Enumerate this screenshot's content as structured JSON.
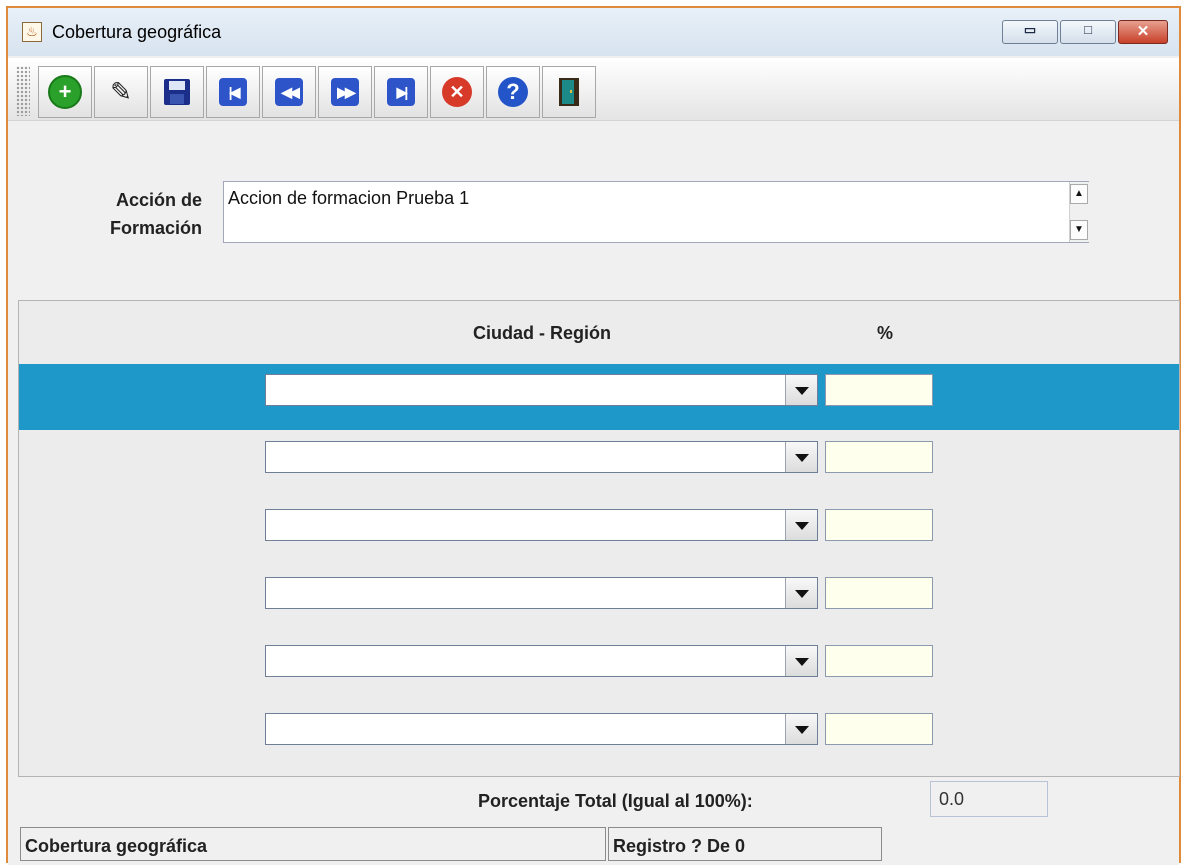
{
  "window": {
    "title": "Cobertura geográfica",
    "controls": {
      "minimize": "▭",
      "maximize": "□",
      "close": "✕"
    }
  },
  "toolbar": {
    "buttons": [
      {
        "name": "add",
        "icon": "plus-circle-icon",
        "glyph": "+",
        "color": "#2aa12a"
      },
      {
        "name": "edit",
        "icon": "pencil-icon",
        "glyph": "✎",
        "color": "#222222"
      },
      {
        "name": "save",
        "icon": "floppy-disk-icon",
        "glyph": "",
        "color": "#1b2f8a"
      },
      {
        "name": "first",
        "icon": "first-record-icon",
        "glyph": "|◀",
        "color": "#2d54c8"
      },
      {
        "name": "previous",
        "icon": "previous-record-icon",
        "glyph": "◀◀",
        "color": "#2d54c8"
      },
      {
        "name": "next",
        "icon": "next-record-icon",
        "glyph": "▶▶",
        "color": "#2d54c8"
      },
      {
        "name": "last",
        "icon": "last-record-icon",
        "glyph": "▶|",
        "color": "#2d54c8"
      },
      {
        "name": "delete",
        "icon": "delete-circle-icon",
        "glyph": "✕",
        "color": "#d83a2a"
      },
      {
        "name": "help",
        "icon": "help-circle-icon",
        "glyph": "?",
        "color": "#2355c8"
      },
      {
        "name": "exit",
        "icon": "exit-door-icon",
        "glyph": "",
        "color": "#3a2a1a"
      }
    ]
  },
  "form": {
    "accion_label_line1": "Acción de",
    "accion_label_line2": "Formación",
    "accion_value": "Accion de formacion Prueba 1"
  },
  "table": {
    "col_city": "Ciudad - Región",
    "col_pct": "%",
    "rows": [
      {
        "city": "",
        "pct": ""
      },
      {
        "city": "",
        "pct": ""
      },
      {
        "city": "",
        "pct": ""
      },
      {
        "city": "",
        "pct": ""
      },
      {
        "city": "",
        "pct": ""
      },
      {
        "city": "",
        "pct": ""
      }
    ],
    "selected_color": "#1e97c9"
  },
  "total": {
    "label": "Porcentaje Total (Igual al 100%):",
    "value": "0.0"
  },
  "status": {
    "module": "Cobertura geográfica",
    "record": "Registro ? De 0"
  }
}
